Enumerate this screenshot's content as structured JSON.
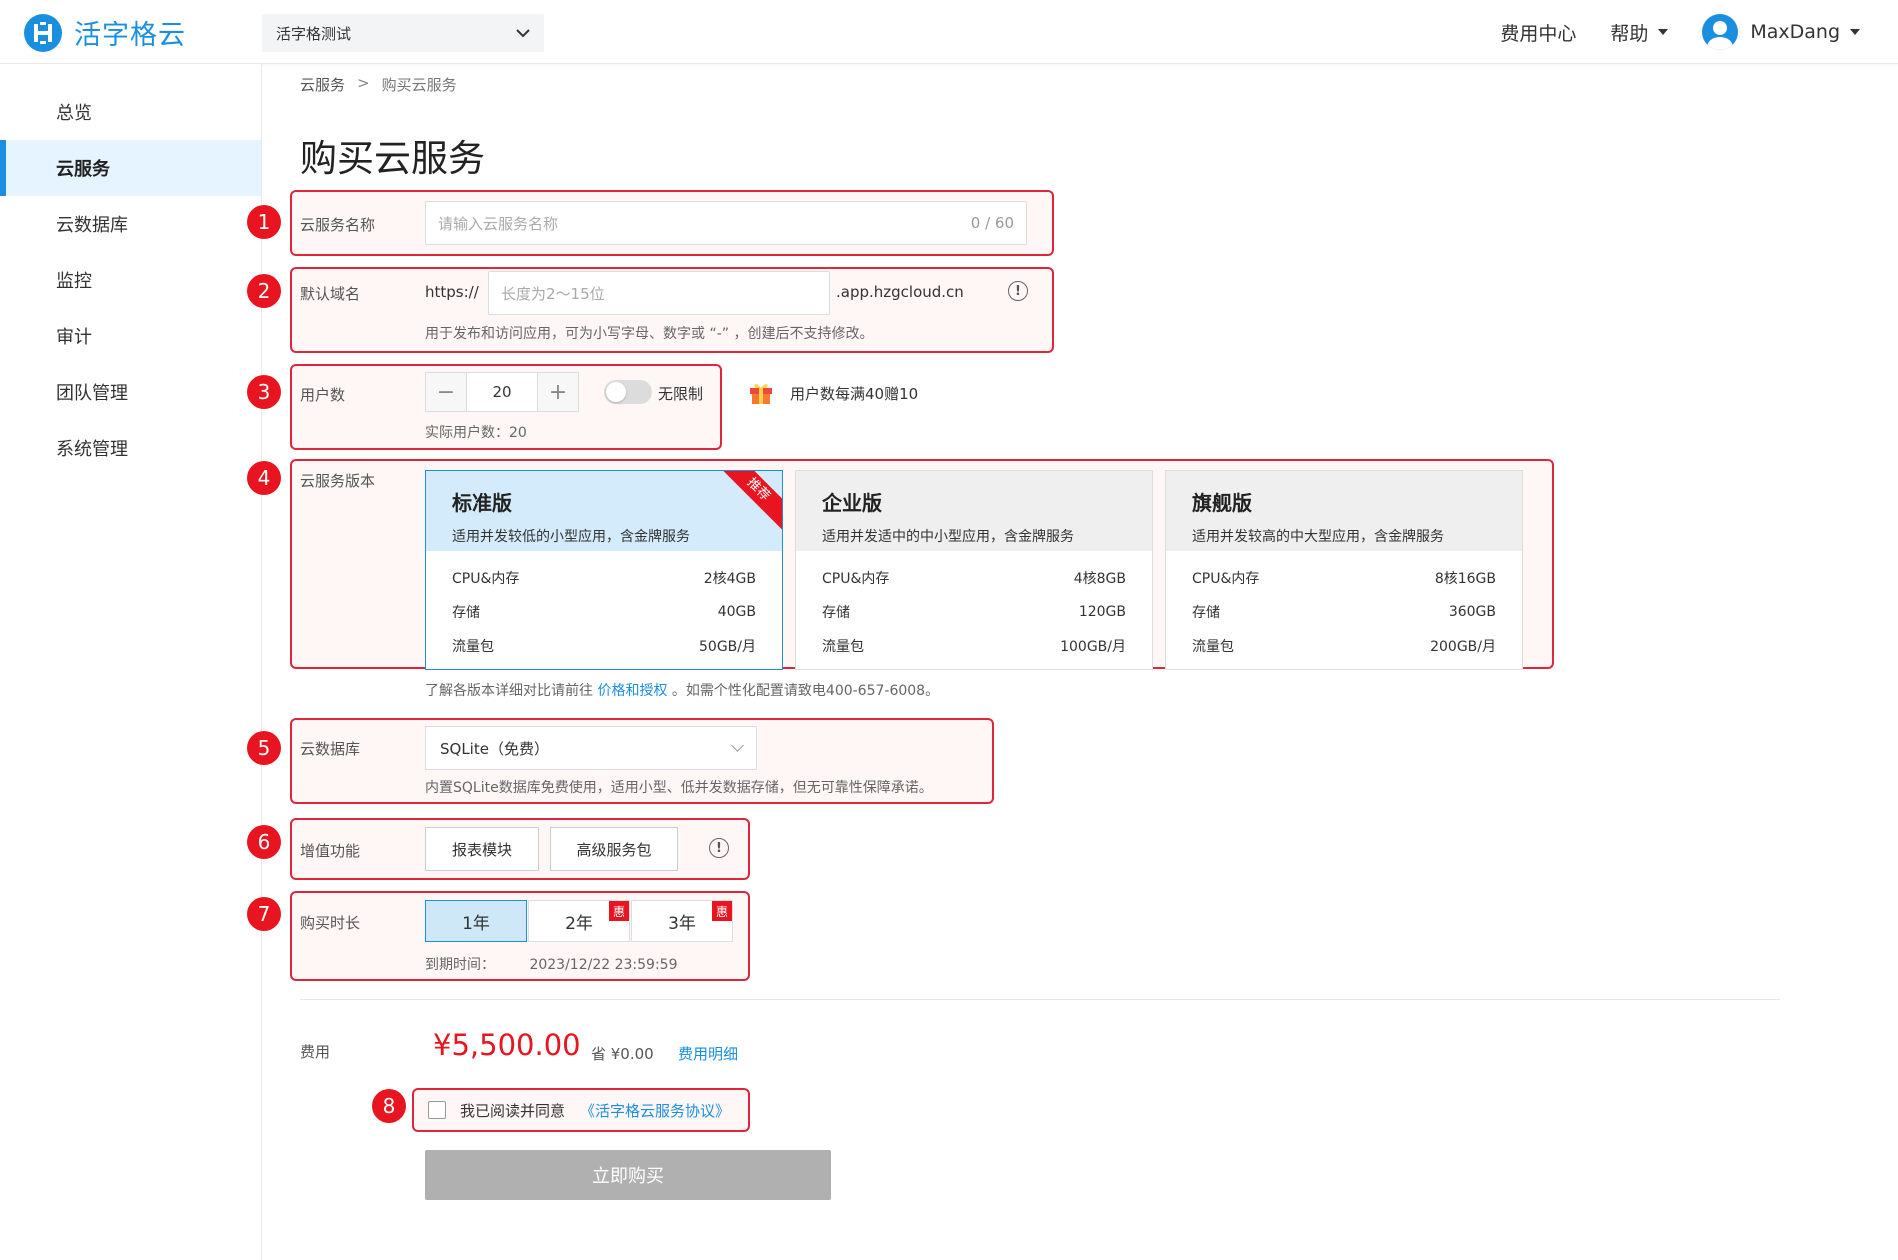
{
  "header": {
    "brand": "活字格云",
    "project_selector": "活字格测试",
    "fee_center": "费用中心",
    "help": "帮助",
    "username": "MaxDang"
  },
  "sidebar": {
    "items": [
      {
        "label": "总览"
      },
      {
        "label": "云服务"
      },
      {
        "label": "云数据库"
      },
      {
        "label": "监控"
      },
      {
        "label": "审计"
      },
      {
        "label": "团队管理"
      },
      {
        "label": "系统管理"
      }
    ],
    "active_index": 1
  },
  "breadcrumb": {
    "root": "云服务",
    "sep": ">",
    "current": "购买云服务"
  },
  "page_title": "购买云服务",
  "badges": [
    "1",
    "2",
    "3",
    "4",
    "5",
    "6",
    "7",
    "8"
  ],
  "form": {
    "name": {
      "label": "云服务名称",
      "placeholder": "请输入云服务名称",
      "counter": "0 / 60"
    },
    "domain": {
      "label": "默认域名",
      "prefix": "https://",
      "placeholder": "长度为2～15位",
      "suffix": ".app.hzgcloud.cn",
      "hint": "用于发布和访问应用，可为小写字母、数字或 “-” ，创建后不支持修改。"
    },
    "users": {
      "label": "用户数",
      "value": "20",
      "unlimited_label": "无限制",
      "actual": "实际用户数：20",
      "promo": "用户数每满40赠10"
    },
    "version": {
      "label": "云服务版本",
      "cards": [
        {
          "name": "标准版",
          "desc": "适用并发较低的小型应用，含金牌服务",
          "ribbon": "推荐",
          "rows": [
            {
              "k": "CPU&内存",
              "v": "2核4GB"
            },
            {
              "k": "存储",
              "v": "40GB"
            },
            {
              "k": "流量包",
              "v": "50GB/月"
            }
          ]
        },
        {
          "name": "企业版",
          "desc": "适用并发适中的中小型应用，含金牌服务",
          "rows": [
            {
              "k": "CPU&内存",
              "v": "4核8GB"
            },
            {
              "k": "存储",
              "v": "120GB"
            },
            {
              "k": "流量包",
              "v": "100GB/月"
            }
          ]
        },
        {
          "name": "旗舰版",
          "desc": "适用并发较高的中大型应用，含金牌服务",
          "rows": [
            {
              "k": "CPU&内存",
              "v": "8核16GB"
            },
            {
              "k": "存储",
              "v": "360GB"
            },
            {
              "k": "流量包",
              "v": "200GB/月"
            }
          ]
        }
      ],
      "note_before": "了解各版本详细对比请前往",
      "note_link": "价格和授权",
      "note_after": "。如需个性化配置请致电400-657-6008。"
    },
    "database": {
      "label": "云数据库",
      "selected": "SQLite（免费）",
      "hint": "内置SQLite数据库免费使用，适用小型、低并发数据存储，但无可靠性保障承诺。"
    },
    "addons": {
      "label": "增值功能",
      "options": [
        "报表模块",
        "高级服务包"
      ]
    },
    "duration": {
      "label": "购买时长",
      "options": [
        {
          "label": "1年"
        },
        {
          "label": "2年",
          "tag": "惠"
        },
        {
          "label": "3年",
          "tag": "惠"
        }
      ],
      "expire_label": "到期时间：",
      "expire_value": "2023/12/22 23:59:59"
    }
  },
  "fee": {
    "label": "费用",
    "price": "¥5,500.00",
    "saved": "省 ¥0.00",
    "detail_link": "费用明细"
  },
  "agreement": {
    "text": "我已阅读并同意",
    "link": "《活字格云服务协议》"
  },
  "buy_button": "立即购买",
  "colors": {
    "accent": "#1a8fe0",
    "highlight": "#e8141f",
    "disabled": "#b0b0b0"
  }
}
